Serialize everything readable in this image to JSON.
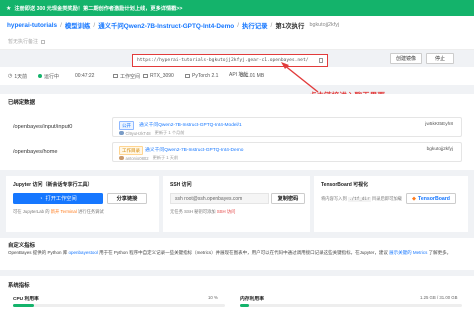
{
  "banner": {
    "text": "注册即送 300 元现金类奖励！第二期创作者激励计划上线，更多详情戳>>"
  },
  "breadcrumb": {
    "items": [
      "hyperai-tutorials",
      "模型训练",
      "通义千问Qwen2-7B-Instruct-GPTQ-Int4-Demo",
      "执行记录"
    ],
    "current": "第1次执行",
    "id": "bgkutojj2kfyj"
  },
  "description": {
    "placeholder": "暂无执行备注"
  },
  "public_url": "https://hyperai-tutorials-bgkutojj2kfyj.gear-c1.openbayes.net/",
  "actions": {
    "create_label": "创建镜像",
    "stop_label": "停止"
  },
  "status": {
    "duration": "1天前",
    "state": "运行中",
    "elapsed": "00:47:22",
    "workspace": "工作空间",
    "gpu": "RTX_3090",
    "framework": "PyTorch 2.1",
    "api_label": "API 地址",
    "api_value": "801.01 MB"
  },
  "annotation": {
    "text": "点击链接进入聊天界面"
  },
  "mounts": {
    "title": "已绑定数据",
    "rows": [
      {
        "path": "/openbayes/input/input0",
        "tag": "公开",
        "name": "通义千问Qwen2-7B-Instruct-GPTQ-Int4-Model/1",
        "owner": "Cl9yuHzkT48",
        "updated": "更新于 1 个月前",
        "id": "jw5kKt5Eyh8"
      },
      {
        "path": "/openbayes/home",
        "tag": "工作目录",
        "name": "通义千问Qwen2-7B-Instruct-GPTQ-Int4-Demo",
        "owner": "antonio0802",
        "updated": "更新于 1 天前",
        "id": "bgkutojj2kfyj"
      }
    ]
  },
  "jupyter": {
    "title": "Jupyter 访问（新会话专享行工具）",
    "open_label": "打开工作空间",
    "share_label": "分享链接",
    "hint_prefix": "可在 JupyterLab 的",
    "hint_link": "新开 Terminal",
    "hint_suffix": "进行任务调试"
  },
  "ssh": {
    "title": "SSH 访问",
    "command": "ssh root@ssh.openbayes.com",
    "copy_label": "复制密码",
    "hint": "无任务 SSH 秘钥可添加",
    "hint_link": "SSH 访问"
  },
  "tensorboard": {
    "title": "TensorBoard 可视化",
    "hint_prefix": "将内容写入到",
    "hint_code": "./tf_dir",
    "hint_suffix": "目录后即可加载",
    "button_label": "TensorBoard"
  },
  "custom_metrics": {
    "title": "自定义指标",
    "body_prefix": "OpenBayes 提供的 Python 库",
    "body_link": "openbayestool",
    "body_middle": "用于在 Python 程序中自定义记录一些关键指标（metrics）并展现在图表中，用户可以在代码中通过调用接口记录这些关键指标，在Jupyter，建议",
    "body_link2": "展示关键的 Metrics",
    "body_suffix": "了解更多。"
  },
  "system": {
    "title": "系统指标",
    "cpu_label": "CPU 利用率",
    "cpu_value": "10 %",
    "mem_label": "内存利用率",
    "mem_value": "1.25 GB / 31.00 GB",
    "cpu_percent": 10,
    "mem_percent": 4
  },
  "colors": {
    "accent": "#1677ff",
    "success": "#14b36b",
    "annotation": "#e23b3b"
  }
}
